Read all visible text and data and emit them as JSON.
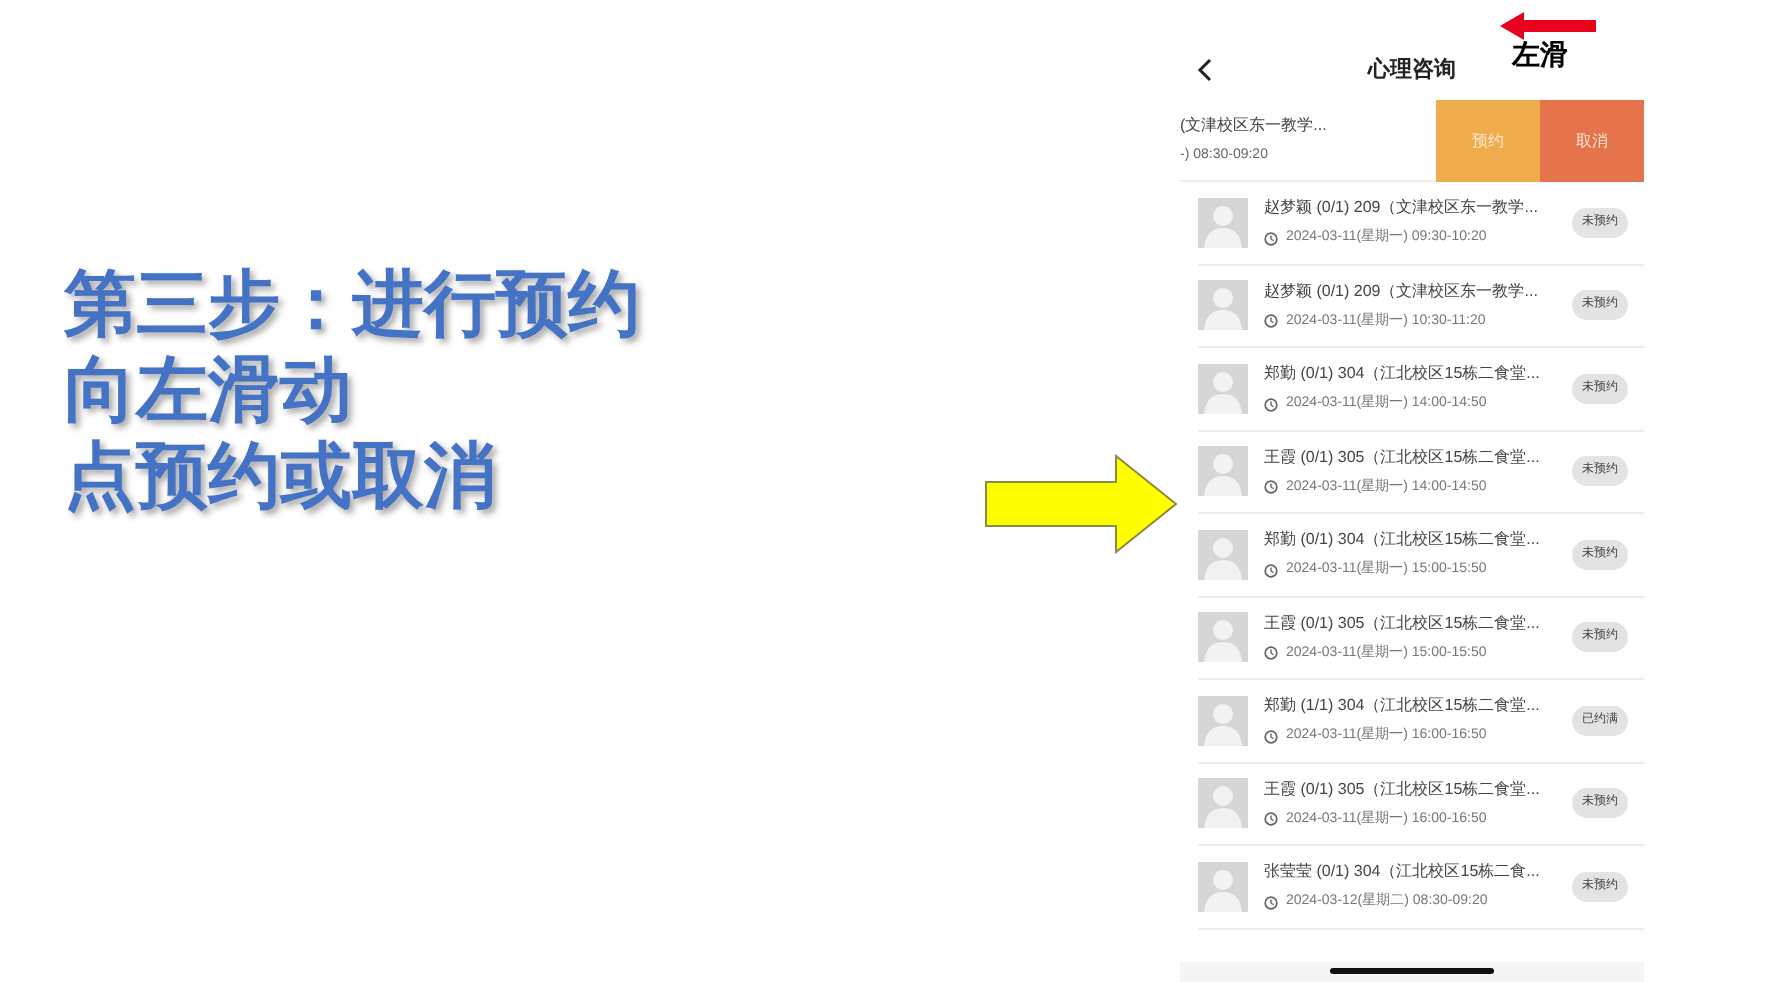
{
  "slide": {
    "heading_lines": [
      "第三步：进行预约",
      "向左滑动",
      "点预约或取消"
    ]
  },
  "annotation": {
    "label": "左滑"
  },
  "app": {
    "title": "心理咨询",
    "swiped_row": {
      "title": "(文津校区东一教学...",
      "time": "-) 08:30-09:20",
      "actions": [
        {
          "label": "预约",
          "kind": "book"
        },
        {
          "label": "取消",
          "kind": "cancel"
        }
      ]
    },
    "rows": [
      {
        "title": "赵梦颖 (0/1) 209（文津校区东一教学...",
        "time": "2024-03-11(星期一) 09:30-10:20",
        "status": "未预约"
      },
      {
        "title": "赵梦颖 (0/1) 209（文津校区东一教学...",
        "time": "2024-03-11(星期一) 10:30-11:20",
        "status": "未预约"
      },
      {
        "title": "郑勤 (0/1) 304（江北校区15栋二食堂...",
        "time": "2024-03-11(星期一) 14:00-14:50",
        "status": "未预约"
      },
      {
        "title": "王霞 (0/1) 305（江北校区15栋二食堂...",
        "time": "2024-03-11(星期一) 14:00-14:50",
        "status": "未预约"
      },
      {
        "title": "郑勤 (0/1) 304（江北校区15栋二食堂...",
        "time": "2024-03-11(星期一) 15:00-15:50",
        "status": "未预约"
      },
      {
        "title": "王霞 (0/1) 305（江北校区15栋二食堂...",
        "time": "2024-03-11(星期一) 15:00-15:50",
        "status": "未预约"
      },
      {
        "title": "郑勤 (1/1) 304（江北校区15栋二食堂...",
        "time": "2024-03-11(星期一) 16:00-16:50",
        "status": "已约满"
      },
      {
        "title": "王霞 (0/1) 305（江北校区15栋二食堂...",
        "time": "2024-03-11(星期一) 16:00-16:50",
        "status": "未预约"
      },
      {
        "title": "张莹莹 (0/1) 304（江北校区15栋二食...",
        "time": "2024-03-12(星期二) 08:30-09:20",
        "status": "未预约"
      }
    ]
  }
}
